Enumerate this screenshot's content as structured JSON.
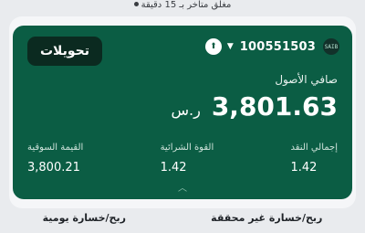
{
  "status": {
    "text": "مغلق  متأخر بـ 15 دقيقة"
  },
  "card": {
    "transfers_label": "تحويلات",
    "account_number": "100551503",
    "logo_text": "SAIB",
    "net_assets_label": "صافي الأصول",
    "net_assets_value": "3,801.63",
    "currency": "ر.س",
    "stats": [
      {
        "label": "إجمالي النقد",
        "value": "1.42"
      },
      {
        "label": "القوة الشرائية",
        "value": "1.42"
      },
      {
        "label": "القيمة السوقية",
        "value": "3,800.21"
      }
    ]
  },
  "tabs": {
    "unrealized": "ربح/خسارة غير محققة",
    "daily": "ربح/خسارة يومية"
  },
  "icons": {
    "up_arrow": "up-arrow-icon",
    "caret": "caret-down-icon",
    "expand": "chevron-up-icon"
  },
  "colors": {
    "card": "#0b5d44",
    "button": "#0b2a20"
  }
}
